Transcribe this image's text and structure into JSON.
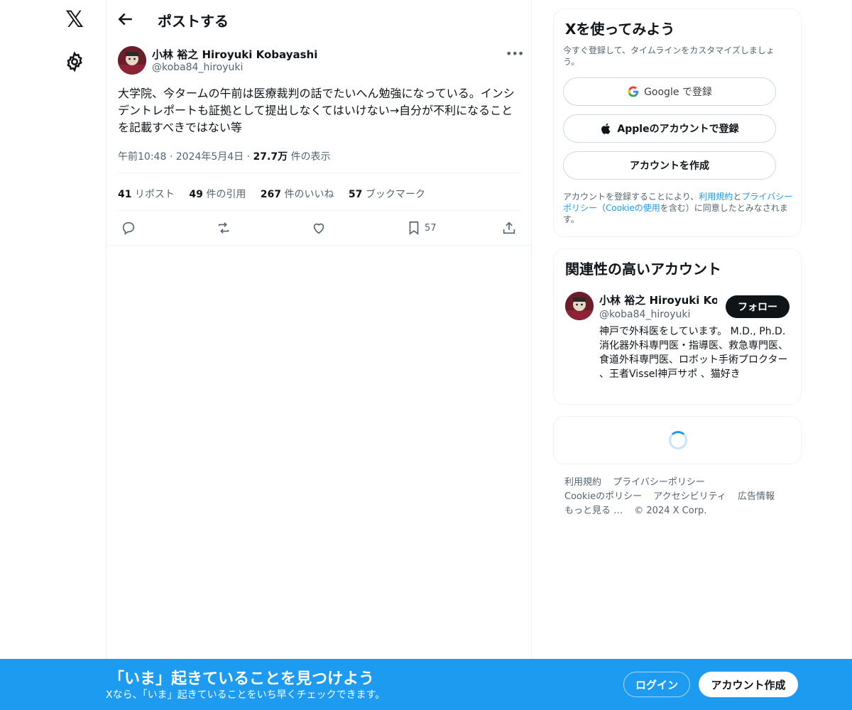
{
  "nav": {
    "logo_icon": "x-logo-icon",
    "logo_glyph": "𝕏",
    "settings_icon": "gear-icon"
  },
  "header": {
    "title": "ポストする",
    "back_icon": "arrow-left-icon"
  },
  "post": {
    "author_name": "小林 裕之 Hiroyuki Kobayashi",
    "author_handle": "@koba84_hiroyuki",
    "more_label": "•••",
    "text": "大学院、今タームの午前は医療裁判の話でたいへん勉強になっている。インシデントレポートも証拠として提出しなくてはいけない→自分が不利になることを記載すべきではない等",
    "time": "午前10:48",
    "date": "2024年5月4日",
    "sep": "·",
    "views": "27.7万",
    "views_label": " 件の表示",
    "stats": {
      "reposts": "41",
      "reposts_label": " リポスト",
      "quotes": "49",
      "quotes_label": " 件の引用",
      "likes": "267",
      "likes_label": " 件のいいね",
      "bookmarks": "57",
      "bookmarks_label": " ブックマーク"
    },
    "actions": {
      "bookmark_count": "57"
    }
  },
  "signup_card": {
    "title": "Xを使ってみよう",
    "subtitle": "今すぐ登録して、タイムラインをカスタマイズしましょう。",
    "google_label": "Google で登録",
    "apple_label": "Appleのアカウントで登録",
    "create_label": "アカウントを作成",
    "legal_prefix": "アカウントを登録することにより、",
    "legal_terms": "利用規約",
    "legal_and": "と",
    "legal_privacy": "プライバシーポリシー",
    "legal_open": "（",
    "legal_cookie": "Cookieの使用",
    "legal_suffix": "を含む）に同意したとみなされます。"
  },
  "related_card": {
    "title": "関連性の高いアカウント",
    "name": "小林 裕之 Hiroyuki Kobayashi",
    "handle": "@koba84_hiroyuki",
    "follow_label": "フォロー",
    "bio": "神戸で外科医をしています。 M.D., Ph.D. 消化器外科専門医・指導医、救急専門医、食道外科専門医、ロボット手術プロクター 、王者Vissel神戸サポ 、猫好き"
  },
  "footer": {
    "terms": "利用規約",
    "privacy": "プライバシーポリシー",
    "cookie": "Cookieのポリシー",
    "accessibility": "アクセシビリティ",
    "ads": "広告情報",
    "more": "もっと見る …",
    "copyright": "© 2024 X Corp."
  },
  "banner": {
    "title": "「いま」起きていることを見つけよう",
    "subtitle": "Xなら、「いま」起きていることをいち早くチェックできます。",
    "login_label": "ログイン",
    "signup_label": "アカウント作成"
  },
  "colors": {
    "accent": "#1d9bf0",
    "text": "#0f1419",
    "muted": "#536471",
    "border": "#eff3f4",
    "banner": "#1d9bf0"
  }
}
